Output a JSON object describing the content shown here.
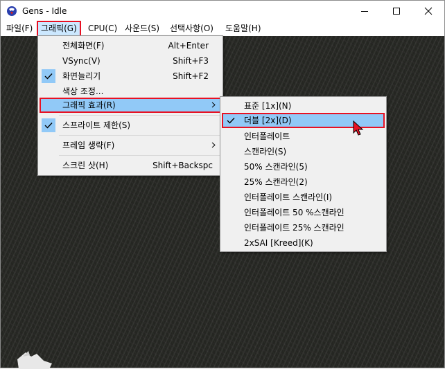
{
  "window": {
    "title": "Gens - Idle"
  },
  "menubar": {
    "items": [
      {
        "label": "파일(F)"
      },
      {
        "label": "그래픽(G)"
      },
      {
        "label": "CPU(C)"
      },
      {
        "label": "사운드(S)"
      },
      {
        "label": "선택사항(O)"
      },
      {
        "label": "도움말(H)"
      }
    ]
  },
  "graphics_menu": {
    "items": [
      {
        "label": "전체화면(F)",
        "accel": "Alt+Enter"
      },
      {
        "label": "VSync(V)",
        "accel": "Shift+F3"
      },
      {
        "label": "화면늘리기",
        "accel": "Shift+F2"
      },
      {
        "label": "색상 조정..."
      },
      {
        "label": "그래픽 효과(R)"
      },
      {
        "label": "스프라이트 제한(S)"
      },
      {
        "label": "프레임 생략(F)"
      },
      {
        "label": "스크린 샷(H)",
        "accel": "Shift+Backspc"
      }
    ]
  },
  "effects_menu": {
    "items": [
      {
        "label": "표준 [1x](N)"
      },
      {
        "label": "더블 [2x](D)"
      },
      {
        "label": "인터폴레이트"
      },
      {
        "label": "스캔라인(S)"
      },
      {
        "label": "50% 스캔라인(5)"
      },
      {
        "label": "25% 스캔라인(2)"
      },
      {
        "label": "인터폴레이트 스캔라인(I)"
      },
      {
        "label": "인터폴레이트 50 %스캔라인"
      },
      {
        "label": "인터폴레이트 25% 스캔라인"
      },
      {
        "label": "2xSAI [Kreed](K)"
      }
    ]
  },
  "colors": {
    "highlight": "#91c9f7",
    "focus_border": "#e81123",
    "menu_bg": "#f0f0f0",
    "content_bg": "#252622"
  }
}
